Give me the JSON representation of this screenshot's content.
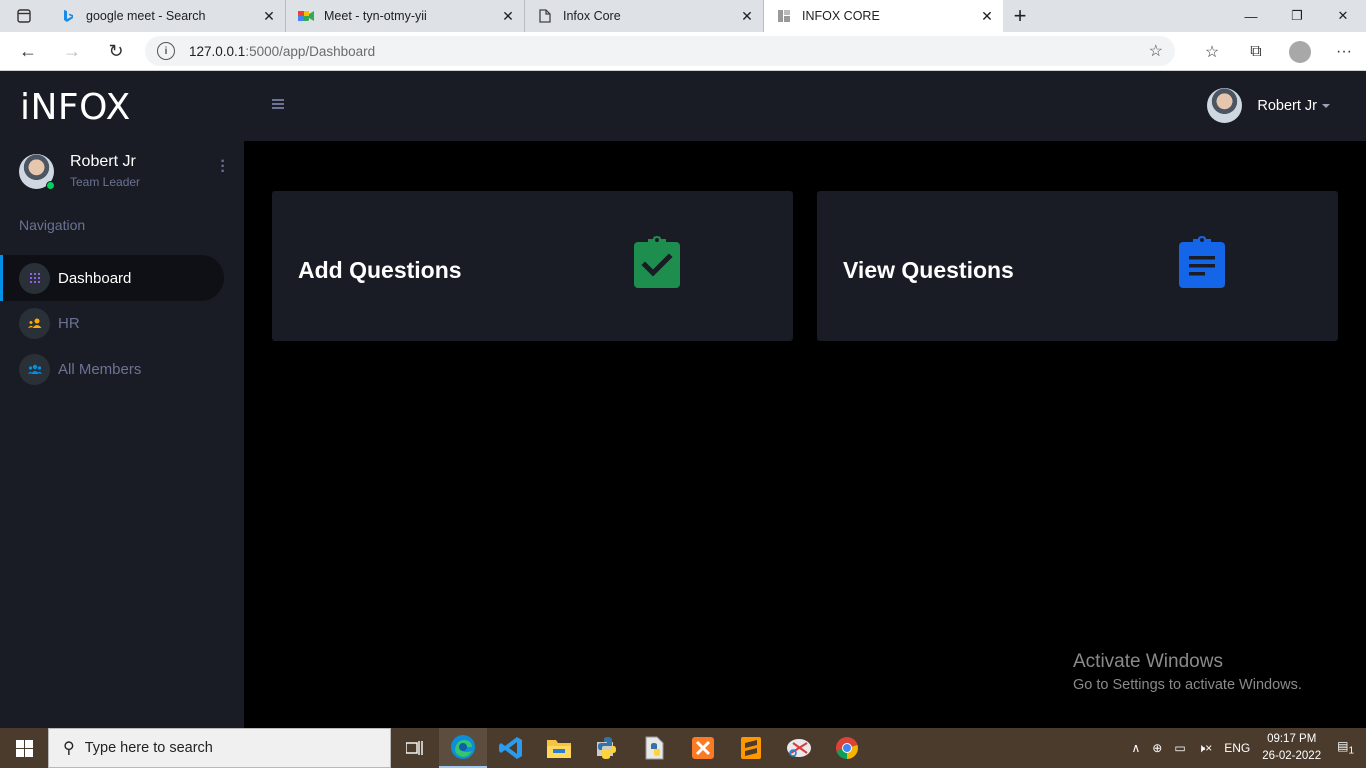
{
  "browser": {
    "tabs": [
      {
        "title": "google meet - Search",
        "icon": "bing-icon"
      },
      {
        "title": "Meet - tyn-otmy-yii",
        "icon": "google-meet-icon"
      },
      {
        "title": "Infox Core",
        "icon": "page-icon"
      },
      {
        "title": "INFOX CORE",
        "icon": "page-icon",
        "active": true
      }
    ],
    "url_host": "127.0.0.1",
    "url_path": ":5000/app/Dashboard"
  },
  "sidebar": {
    "logo": "iNFOX",
    "user": {
      "name": "Robert Jr",
      "role": "Team Leader"
    },
    "nav_heading": "Navigation",
    "items": [
      {
        "label": "Dashboard",
        "icon": "grid-icon",
        "icon_color": "#8f5fe8",
        "active": true
      },
      {
        "label": "HR",
        "icon": "user-group-icon",
        "icon_color": "#ffab00"
      },
      {
        "label": "All Members",
        "icon": "members-icon",
        "icon_color": "#0090e7"
      }
    ]
  },
  "topbar": {
    "user_name": "Robert Jr"
  },
  "cards": [
    {
      "title": "Add Questions",
      "icon": "clipboard-check-icon",
      "icon_color": "#1e8e4f"
    },
    {
      "title": "View Questions",
      "icon": "clipboard-list-icon",
      "icon_color": "#1565e8"
    }
  ],
  "watermark": {
    "title": "Activate Windows",
    "subtitle": "Go to Settings to activate Windows."
  },
  "taskbar": {
    "search_placeholder": "Type here to search",
    "language": "ENG",
    "time": "09:17 PM",
    "date": "26-02-2022",
    "notification_count": "1"
  }
}
